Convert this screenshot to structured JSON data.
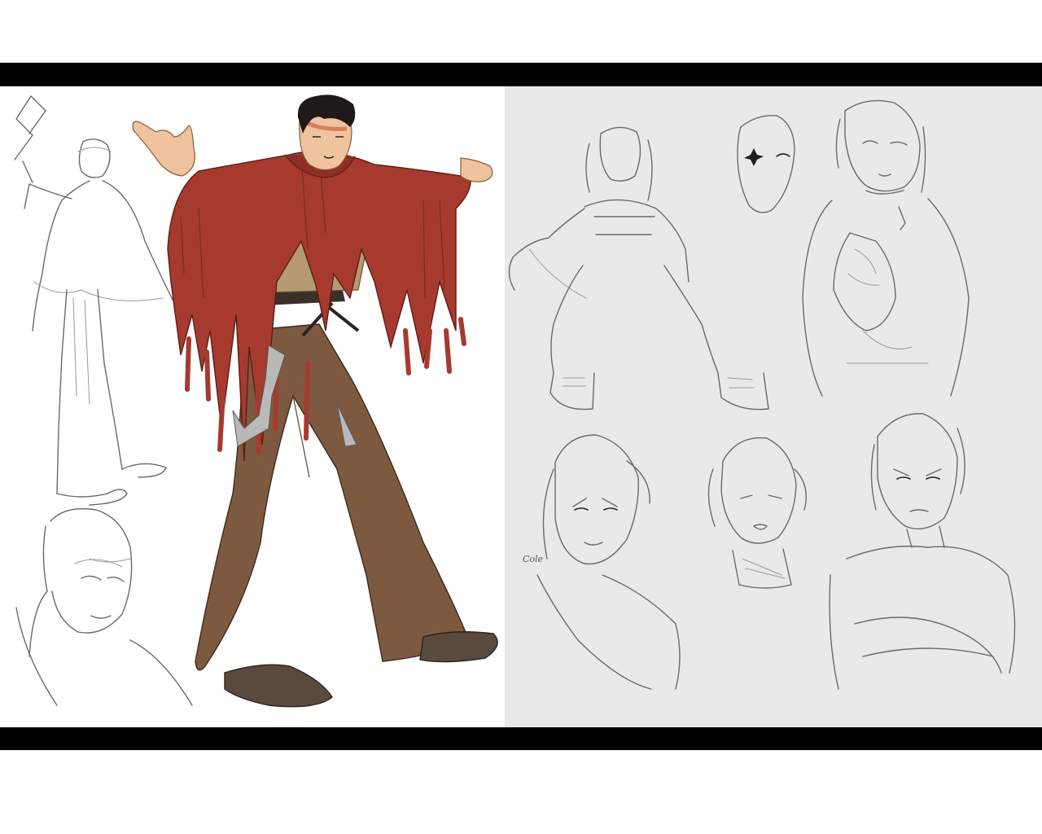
{
  "artwork": {
    "left_panel": {
      "figures": [
        "sketch-full-body-left",
        "sketch-head-portrait",
        "colored-character-red-poncho"
      ],
      "colors": {
        "poncho": "#a63a2e",
        "shirt": "#b59a74",
        "pants": "#7d5a3f",
        "shoes": "#5a4a3d",
        "hair": "#1f1a18",
        "skin": "#efc39d",
        "blade": "#b9b9b9"
      }
    },
    "right_panel": {
      "figures": [
        "sketch-hooded-figure",
        "sketch-mask",
        "sketch-portrait-cloak",
        "sketch-angry-face",
        "sketch-worried-face",
        "sketch-arms-crossed"
      ],
      "signature": "Cole",
      "colors": {
        "background": "#e9e9ea",
        "pencil": "#6a6a6a"
      }
    }
  }
}
